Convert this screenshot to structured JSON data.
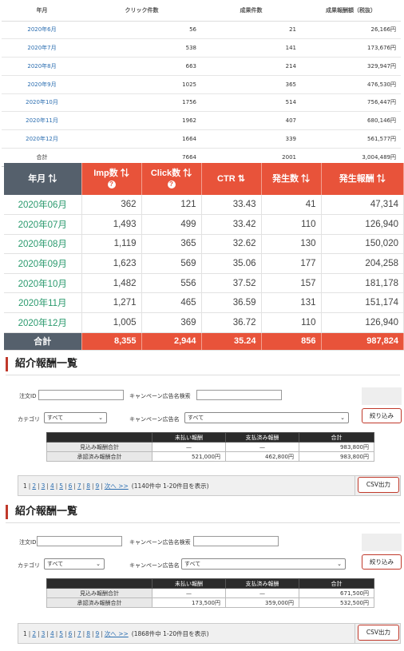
{
  "monthly_summary": {
    "headers": [
      "年月",
      "クリック件数",
      "成果件数",
      "成果報酬額（税抜）"
    ],
    "rows": [
      {
        "month": "2020年6月",
        "clicks": "56",
        "results": "21",
        "reward": "26,166円"
      },
      {
        "month": "2020年7月",
        "clicks": "538",
        "results": "141",
        "reward": "173,676円"
      },
      {
        "month": "2020年8月",
        "clicks": "663",
        "results": "214",
        "reward": "329,947円"
      },
      {
        "month": "2020年9月",
        "clicks": "1025",
        "results": "365",
        "reward": "476,530円"
      },
      {
        "month": "2020年10月",
        "clicks": "1756",
        "results": "514",
        "reward": "756,447円"
      },
      {
        "month": "2020年11月",
        "clicks": "1962",
        "results": "407",
        "reward": "680,146円"
      },
      {
        "month": "2020年12月",
        "clicks": "1664",
        "results": "339",
        "reward": "561,577円"
      }
    ],
    "total": {
      "label": "合計",
      "clicks": "7664",
      "results": "2001",
      "reward": "3,004,489円"
    }
  },
  "stats_table": {
    "headers": {
      "month": "年月 ⇅",
      "imp": "Imp数 ⇅",
      "click": "Click数 ⇅",
      "ctr": "CTR ⇅",
      "occ": "発生数 ⇅",
      "reward": "発生報酬 ⇅",
      "help": "?"
    },
    "rows": [
      {
        "month": "2020年06月",
        "imp": "362",
        "click": "121",
        "ctr": "33.43",
        "occ": "41",
        "reward": "47,314"
      },
      {
        "month": "2020年07月",
        "imp": "1,493",
        "click": "499",
        "ctr": "33.42",
        "occ": "110",
        "reward": "126,940"
      },
      {
        "month": "2020年08月",
        "imp": "1,119",
        "click": "365",
        "ctr": "32.62",
        "occ": "130",
        "reward": "150,020"
      },
      {
        "month": "2020年09月",
        "imp": "1,623",
        "click": "569",
        "ctr": "35.06",
        "occ": "177",
        "reward": "204,258"
      },
      {
        "month": "2020年10月",
        "imp": "1,482",
        "click": "556",
        "ctr": "37.52",
        "occ": "157",
        "reward": "181,178"
      },
      {
        "month": "2020年11月",
        "imp": "1,271",
        "click": "465",
        "ctr": "36.59",
        "occ": "131",
        "reward": "151,174"
      },
      {
        "month": "2020年12月",
        "imp": "1,005",
        "click": "369",
        "ctr": "36.72",
        "occ": "110",
        "reward": "126,940"
      }
    ],
    "total": {
      "month": "合計",
      "imp": "8,355",
      "click": "2,944",
      "ctr": "35.24",
      "occ": "856",
      "reward": "987,824"
    }
  },
  "report_sections": [
    {
      "title": "紹介報酬一覧",
      "order_id_label": "注文ID",
      "campaign_search_label": "キャンペーン広告名検索",
      "category_label": "カテゴリ",
      "category_value": "すべて",
      "campaign_name_label": "キャンペーン広告名",
      "campaign_value": "すべて",
      "filter_button": "絞り込み",
      "summary_headers": [
        "",
        "未払い報酬",
        "支払済み報酬",
        "合計"
      ],
      "summary_rows": [
        {
          "label": "見込み報酬合計",
          "unpaid": "—",
          "paid": "—",
          "total": "983,800円"
        },
        {
          "label": "承認済み報酬合計",
          "unpaid": "521,000円",
          "paid": "462,800円",
          "total": "983,800円"
        }
      ],
      "pages": [
        "1",
        "2",
        "3",
        "4",
        "5",
        "6",
        "7",
        "8",
        "9"
      ],
      "next_label": "次へ >>",
      "pager_info": "(1140件中 1-20件目を表示)",
      "csv_button": "CSV出力"
    },
    {
      "title": "紹介報酬一覧",
      "order_id_label": "注文ID",
      "campaign_search_label": "キャンペーン広告名検索",
      "category_label": "カテゴリ",
      "category_value": "すべて",
      "campaign_name_label": "キャンペーン広告名",
      "campaign_value": "すべて",
      "filter_button": "絞り込み",
      "summary_headers": [
        "",
        "未払い報酬",
        "支払済み報酬",
        "合計"
      ],
      "summary_rows": [
        {
          "label": "見込み報酬合計",
          "unpaid": "—",
          "paid": "—",
          "total": "671,500円"
        },
        {
          "label": "承認済み報酬合計",
          "unpaid": "173,500円",
          "paid": "359,000円",
          "total": "532,500円"
        }
      ],
      "pages": [
        "1",
        "2",
        "3",
        "4",
        "5",
        "6",
        "7",
        "8",
        "9"
      ],
      "next_label": "次へ >>",
      "pager_info": "(1868件中 1-20件目を表示)",
      "csv_button": "CSV出力"
    }
  ],
  "colors": {
    "accent": "#e8533a",
    "header_dark": "#55606c",
    "month_link": "#2b9a6e",
    "link": "#2a6db0"
  }
}
